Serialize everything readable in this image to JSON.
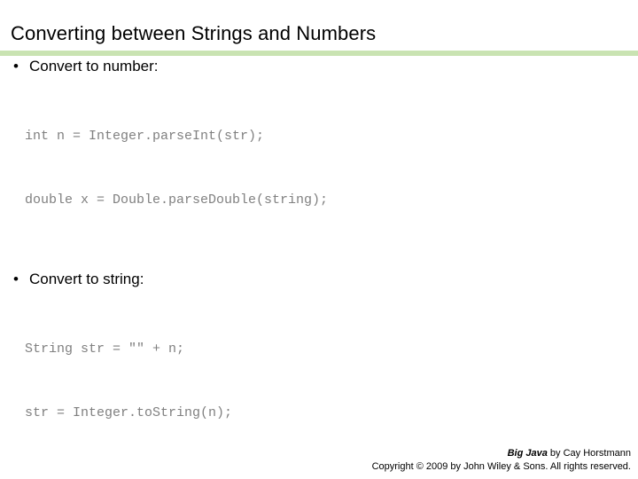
{
  "slide": {
    "title": "Converting between Strings and Numbers",
    "accent_color": "#c9e3b2",
    "code_color": "#808080",
    "text_color": "#000000",
    "background_color": "#ffffff",
    "bullet_glyph": "•",
    "sections": [
      {
        "bullet": "Convert to number:",
        "code": [
          "int n = Integer.parseInt(str);",
          "double x = Double.parseDouble(string);"
        ]
      },
      {
        "bullet": "Convert to string:",
        "code": [
          "String str = \"\" + n;",
          "str = Integer.toString(n);"
        ]
      }
    ]
  },
  "footer": {
    "book_title": "Big Java",
    "byline": " by Cay Horstmann",
    "copyright": "Copyright © 2009 by John Wiley & Sons.  All rights reserved."
  }
}
